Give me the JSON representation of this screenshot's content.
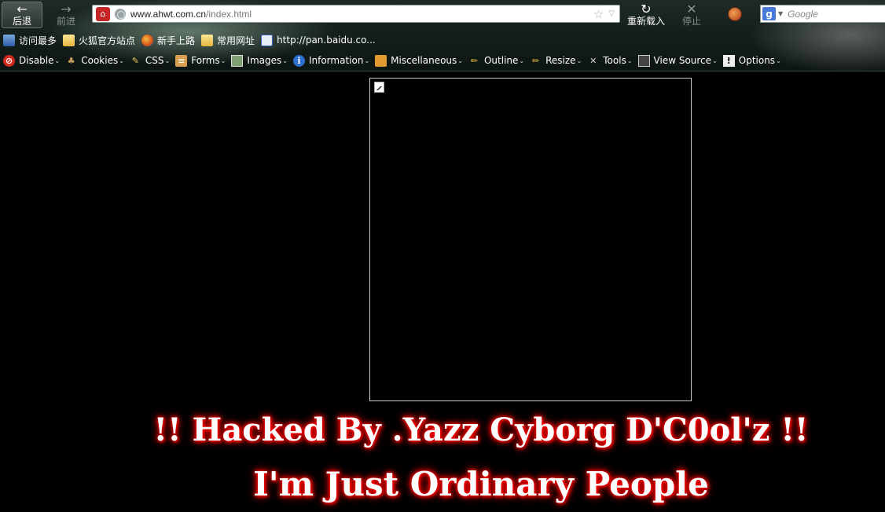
{
  "navbar": {
    "back_label": "后退",
    "forward_label": "前进",
    "reload_label": "重新载入",
    "stop_label": "停止",
    "url_host": "www.ahwt.com.cn",
    "url_path": "/index.html",
    "search_placeholder": "Google",
    "back_icon": "←",
    "forward_icon": "→",
    "reload_icon": "↻",
    "stop_icon": "✕"
  },
  "bookmarks": [
    {
      "label": "访问最多",
      "icon": "recent-icon"
    },
    {
      "label": "火狐官方站点",
      "icon": "folder-icon"
    },
    {
      "label": "新手上路",
      "icon": "firefox-icon"
    },
    {
      "label": "常用网址",
      "icon": "folder-icon"
    },
    {
      "label": "http://pan.baidu.co...",
      "icon": "baidu-icon"
    }
  ],
  "devbar": [
    {
      "label": "Disable",
      "icon": "disable-icon"
    },
    {
      "label": "Cookies",
      "icon": "cookies-icon"
    },
    {
      "label": "CSS",
      "icon": "css-icon"
    },
    {
      "label": "Forms",
      "icon": "forms-icon"
    },
    {
      "label": "Images",
      "icon": "images-icon"
    },
    {
      "label": "Information",
      "icon": "info-icon"
    },
    {
      "label": "Miscellaneous",
      "icon": "misc-icon"
    },
    {
      "label": "Outline",
      "icon": "outline-icon"
    },
    {
      "label": "Resize",
      "icon": "resize-icon"
    },
    {
      "label": "Tools",
      "icon": "tools-icon"
    },
    {
      "label": "View Source",
      "icon": "source-icon"
    },
    {
      "label": "Options",
      "icon": "options-icon"
    }
  ],
  "page": {
    "headline": "!! Hacked By .Yazz Cyborg D'C0ol'z !!",
    "subline": "I'm Just Ordinary People"
  },
  "colors": {
    "background": "#000000",
    "glow": "#ff0000",
    "text": "#ffffff"
  }
}
